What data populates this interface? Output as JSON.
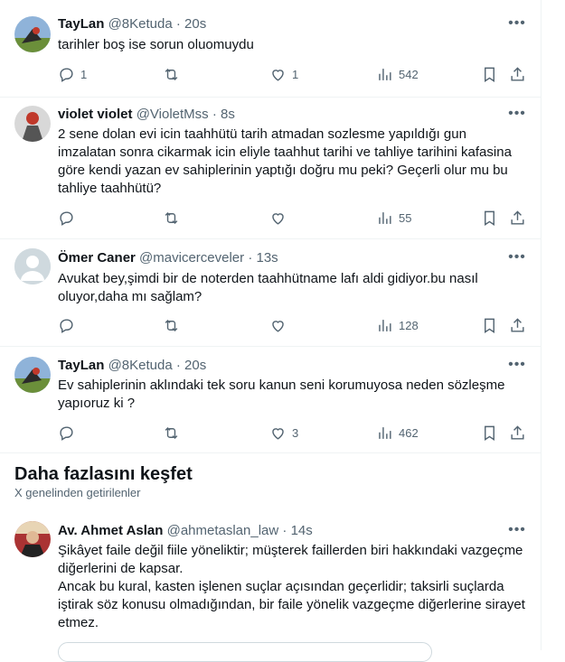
{
  "tweets": [
    {
      "name": "TayLan",
      "handle": "@8Ketuda",
      "time": "20s",
      "text": "tarihler boş ise sorun oluomuydu",
      "replies": "1",
      "retweets": "",
      "likes": "1",
      "views": "542"
    },
    {
      "name": "violet violet",
      "handle": "@VioletMss",
      "time": "8s",
      "text": "2 sene dolan evi icin taahhütü tarih atmadan sozlesme yapıldığı gun imzalatan sonra cikarmak icin eliyle taahhut tarihi ve tahliye tarihini kafasina göre kendi yazan ev sahiplerinin yaptığı doğru mu peki? Geçerli olur mu bu tahliye taahhütü?",
      "replies": "",
      "retweets": "",
      "likes": "",
      "views": "55"
    },
    {
      "name": "Ömer Caner",
      "handle": "@mavicerceveler",
      "time": "13s",
      "text": "Avukat bey,şimdi bir de noterden taahhütname lafı aldi gidiyor.bu nasıl oluyor,daha mı sağlam?",
      "replies": "",
      "retweets": "",
      "likes": "",
      "views": "128"
    },
    {
      "name": "TayLan",
      "handle": "@8Ketuda",
      "time": "20s",
      "text": "Ev sahiplerinin aklındaki tek soru kanun seni korumuyosa neden sözleşme yapıoruz ki ?",
      "replies": "",
      "retweets": "",
      "likes": "3",
      "views": "462"
    }
  ],
  "discover": {
    "title": "Daha fazlasını keşfet",
    "subtitle": "X genelinden getirilenler"
  },
  "featured": {
    "name": "Av. Ahmet Aslan",
    "handle": "@ahmetaslan_law",
    "time": "14s",
    "text": "Şikâyet faile değil fiile yöneliktir; müşterek faillerden biri hakkındaki vazgeçme diğerlerini de kapsar.\nAncak bu kural, kasten işlenen suçlar açısından geçerlidir; taksirli suçlarda iştirak söz konusu olmadığından, bir faile yönelik vazgeçme diğerlerine sirayet etmez."
  },
  "icons": [
    "reply-icon",
    "retweet-icon",
    "like-icon",
    "views-icon",
    "bookmark-icon",
    "share-icon",
    "more-icon"
  ],
  "colors": {
    "text": "#0f1419",
    "secondary": "#536471",
    "divider": "#eff3f4"
  }
}
